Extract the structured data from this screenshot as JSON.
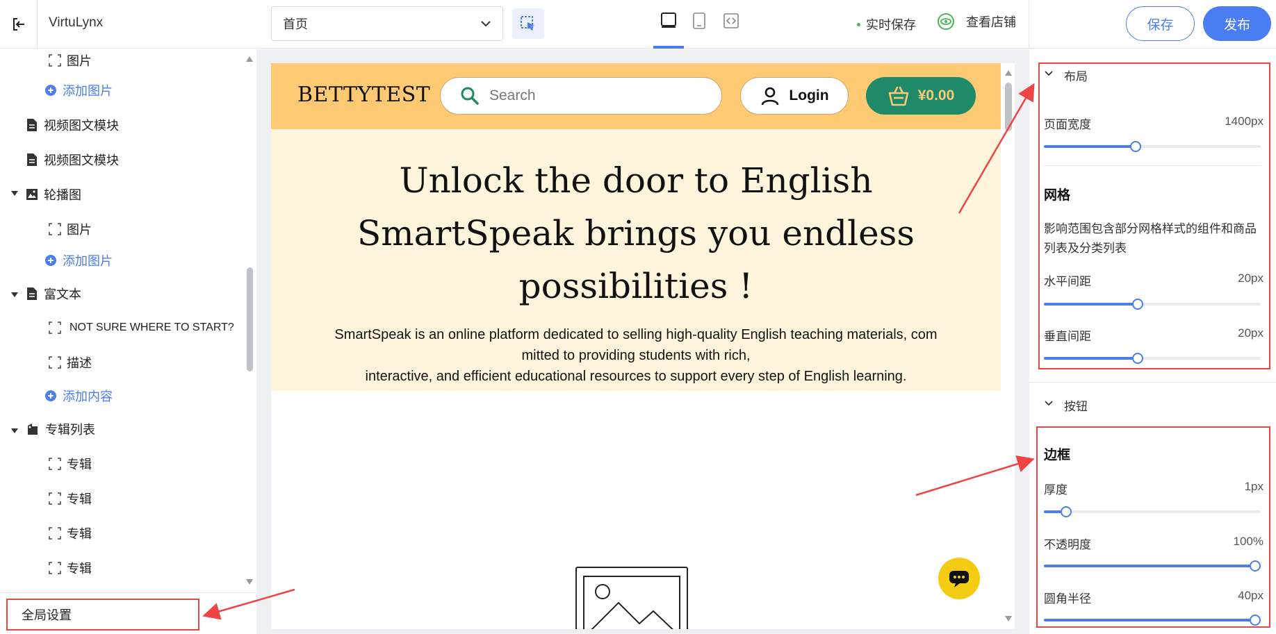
{
  "app": {
    "title": "VirtuLynx"
  },
  "toolbar": {
    "page_select_value": "首页",
    "realtime_save": "实时保存",
    "view_store": "查看店铺",
    "save_label": "保存",
    "publish_label": "发布"
  },
  "sidebar": {
    "items": [
      {
        "label": "图片",
        "icon": "frame-icon"
      },
      {
        "label": "添加图片",
        "icon": "plus-circle-icon"
      },
      {
        "label": "视频图文模块",
        "icon": "document-icon"
      },
      {
        "label": "视频图文模块",
        "icon": "document-icon"
      },
      {
        "label": "轮播图",
        "icon": "image-icon"
      },
      {
        "label": "图片",
        "icon": "frame-icon"
      },
      {
        "label": "添加图片",
        "icon": "plus-circle-icon"
      },
      {
        "label": "富文本",
        "icon": "document-icon"
      },
      {
        "label": "NOT SURE WHERE TO START?",
        "icon": "frame-icon"
      },
      {
        "label": "描述",
        "icon": "frame-icon"
      },
      {
        "label": "添加内容",
        "icon": "plus-circle-icon"
      },
      {
        "label": "专辑列表",
        "icon": "tag-icon"
      },
      {
        "label": "专辑",
        "icon": "frame-icon"
      },
      {
        "label": "专辑",
        "icon": "frame-icon"
      },
      {
        "label": "专辑",
        "icon": "frame-icon"
      },
      {
        "label": "专辑",
        "icon": "frame-icon"
      }
    ],
    "global_settings": "全局设置"
  },
  "preview": {
    "brand": "BETTYTEST",
    "search_placeholder": "Search",
    "login": "Login",
    "cart_total": "¥0.00",
    "hero_title": "Unlock the door to English SmartSpeak brings you endless possibilities !",
    "hero_desc_line1": "SmartSpeak is an online platform dedicated to selling high-quality English teaching materials, com",
    "hero_desc_line2": "mitted to providing students with rich,",
    "hero_desc_line3": "interactive, and efficient educational resources to support every step of English learning."
  },
  "settings": {
    "layout": {
      "title": "布局",
      "page_width_label": "页面宽度",
      "page_width_value": "1400px",
      "page_width_level": 0.42
    },
    "grid": {
      "title": "网格",
      "description_line1": "影响范围包含部分网格样式的组件和商品",
      "description_line2": "列表及分类列表",
      "horizontal_label": "水平间距",
      "horizontal_value": "20px",
      "horizontal_level": 0.43,
      "vertical_label": "垂直间距",
      "vertical_value": "20px",
      "vertical_level": 0.43
    },
    "button": {
      "title": "按钮",
      "border_title": "边框",
      "thickness_label": "厚度",
      "thickness_value": "1px",
      "thickness_level": 0.08,
      "opacity_label": "不透明度",
      "opacity_value": "100%",
      "opacity_level": 1.0,
      "radius_label": "圆角半径",
      "radius_value": "40px",
      "radius_level": 1.0
    }
  },
  "colors": {
    "accent": "#4a7df2",
    "header_bg": "#fdc973",
    "hero_bg": "#fff5dc",
    "cart_bg": "#1f8a6a",
    "annotation": "#ee4444",
    "chat_fab": "#f4cc14"
  }
}
